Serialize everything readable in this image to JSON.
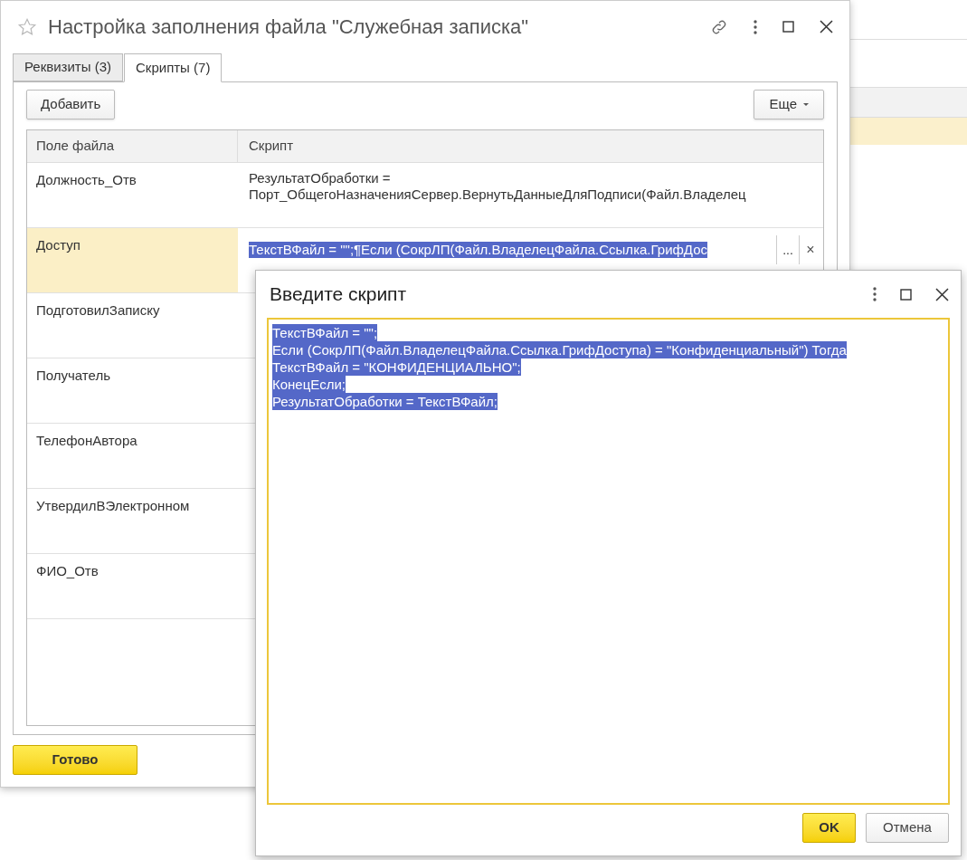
{
  "window": {
    "title": "Настройка заполнения файла \"Служебная записка\""
  },
  "tabs": [
    {
      "label": "Реквизиты (3)",
      "selected": false
    },
    {
      "label": "Скрипты (7)",
      "selected": true
    }
  ],
  "toolbar": {
    "add_button": "Добавить",
    "more_button": "Еще"
  },
  "table": {
    "columns": [
      "Поле файла",
      "Скрипт"
    ],
    "rows": [
      {
        "field": "Должность_Отв",
        "selected": false,
        "kind": "text",
        "script": [
          "РезультатОбработки =",
          "Порт_ОбщегоНазначенияСервер.ВернутьДанныеДляПодписи(Файл.Владелец"
        ]
      },
      {
        "field": "Доступ",
        "selected": true,
        "kind": "editor",
        "editor": {
          "value": "ТекстВФайл = \"\";¶Если (СокрЛП(Файл.ВладелецФайла.Ссылка.ГрифДос",
          "text_selected": true,
          "choose_button": "...",
          "clear_button": "×"
        }
      },
      {
        "field": "ПодготовилЗаписку",
        "selected": false,
        "kind": "text"
      },
      {
        "field": "Получатель",
        "selected": false,
        "kind": "text"
      },
      {
        "field": "ТелефонАвтора",
        "selected": false,
        "kind": "text"
      },
      {
        "field": "УтвердилВЭлектронном",
        "selected": false,
        "kind": "text"
      },
      {
        "field": "ФИО_Отв",
        "selected": false,
        "kind": "text"
      }
    ]
  },
  "done_button": "Готово",
  "dialog": {
    "title": "Введите скрипт",
    "text_selected": true,
    "lines": [
      "ТекстВФайл = \"\";",
      "Если (СокрЛП(Файл.ВладелецФайла.Ссылка.ГрифДоступа) = \"Конфиденциальный\") Тогда",
      "ТекстВФайл = \"КОНФИДЕНЦИАЛЬНО\";",
      "КонецЕсли;",
      "РезультатОбработки = ТекстВФайл;"
    ],
    "ok_button": "OK",
    "cancel_button": "Отмена"
  }
}
